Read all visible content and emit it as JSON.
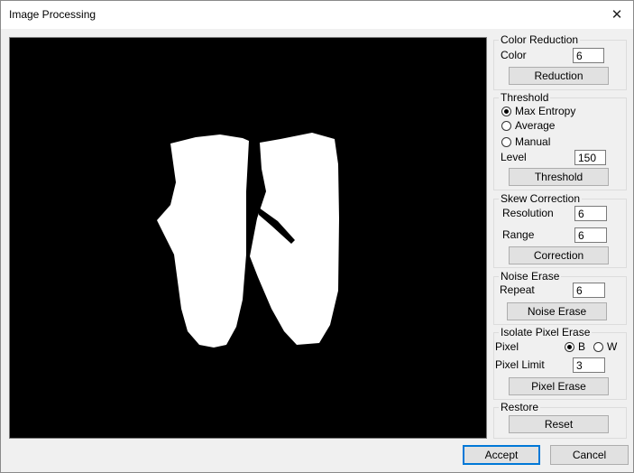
{
  "window": {
    "title": "Image Processing",
    "close_glyph": "✕"
  },
  "color_reduction": {
    "legend": "Color Reduction",
    "color_label": "Color",
    "color_value": "6",
    "button": "Reduction"
  },
  "threshold": {
    "legend": "Threshold",
    "options": [
      "Max Entropy",
      "Average",
      "Manual"
    ],
    "selected": "Max Entropy",
    "level_label": "Level",
    "level_value": "150",
    "button": "Threshold"
  },
  "skew_correction": {
    "legend": "Skew Correction",
    "resolution_label": "Resolution",
    "resolution_value": "6",
    "range_label": "Range",
    "range_value": "6",
    "button": "Correction"
  },
  "noise_erase": {
    "legend": "Noise Erase",
    "repeat_label": "Repeat",
    "repeat_value": "6",
    "button": "Noise Erase"
  },
  "isolate_pixel_erase": {
    "legend": "Isolate Pixel Erase",
    "pixel_label": "Pixel",
    "option_b": "B",
    "option_w": "W",
    "selected": "B",
    "limit_label": "Pixel Limit",
    "limit_value": "3",
    "button": "Pixel Erase"
  },
  "restore": {
    "legend": "Restore",
    "button": "Reset"
  },
  "dialog": {
    "accept": "Accept",
    "cancel": "Cancel"
  },
  "icons": [
    "close-icon",
    "radio-icon"
  ],
  "colors": {
    "canvas_bg": "#000000",
    "shape": "#ffffff",
    "accent": "#0078d7",
    "button_bg": "#e1e1e1"
  }
}
